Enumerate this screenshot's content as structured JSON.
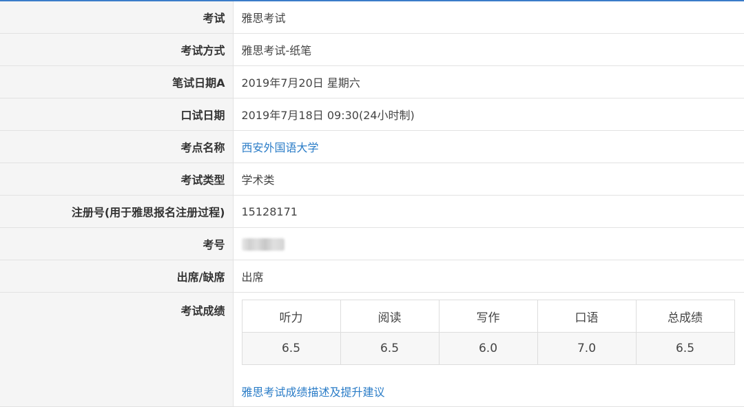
{
  "rows": [
    {
      "label": "考试",
      "value": "雅思考试"
    },
    {
      "label": "考试方式",
      "value": "雅思考试-纸笔"
    },
    {
      "label": "笔试日期A",
      "value": "2019年7月20日 星期六"
    },
    {
      "label": "口试日期",
      "value": "2019年7月18日 09:30(24小时制)"
    },
    {
      "label": "考点名称",
      "value": "西安外国语大学"
    },
    {
      "label": "考试类型",
      "value": "学术类"
    },
    {
      "label": "注册号(用于雅思报名注册过程)",
      "value": "15128171"
    },
    {
      "label": "考号",
      "value": ""
    },
    {
      "label": "出席/缺席",
      "value": "出席"
    }
  ],
  "scores": {
    "label": "考试成绩",
    "headers": [
      "听力",
      "阅读",
      "写作",
      "口语",
      "总成绩"
    ],
    "values": [
      "6.5",
      "6.5",
      "6.0",
      "7.0",
      "6.5"
    ],
    "advice_link": "雅思考试成绩描述及提升建议"
  },
  "colors": {
    "link": "#2a7cc7",
    "label_bg": "#f5f5f5",
    "accent": "#3a7cc9"
  }
}
